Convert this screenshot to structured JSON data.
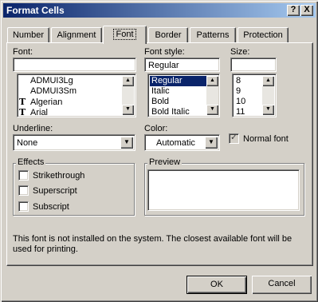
{
  "dialog": {
    "title": "Format Cells",
    "help_label": "?",
    "close_label": "X"
  },
  "tabs": [
    {
      "label": "Number"
    },
    {
      "label": "Alignment"
    },
    {
      "label": "Font"
    },
    {
      "label": "Border"
    },
    {
      "label": "Patterns"
    },
    {
      "label": "Protection"
    }
  ],
  "font": {
    "label": "Font:",
    "value": "",
    "items": [
      {
        "label": "ADMUI3Lg",
        "glyph": ""
      },
      {
        "label": "ADMUI3Sm",
        "glyph": ""
      },
      {
        "label": "Algerian",
        "glyph": "T"
      },
      {
        "label": "Arial",
        "glyph": "T"
      }
    ]
  },
  "font_style": {
    "label": "Font style:",
    "value": "Regular",
    "items": [
      {
        "label": "Regular"
      },
      {
        "label": "Italic"
      },
      {
        "label": "Bold"
      },
      {
        "label": "Bold Italic"
      }
    ]
  },
  "size": {
    "label": "Size:",
    "value": "",
    "items": [
      {
        "label": "8"
      },
      {
        "label": "9"
      },
      {
        "label": "10"
      },
      {
        "label": "11"
      }
    ]
  },
  "underline": {
    "label": "Underline:",
    "value": "None"
  },
  "color": {
    "label": "Color:",
    "value": "Automatic"
  },
  "normal_font": {
    "label": "Normal font",
    "checked": true
  },
  "effects": {
    "label": "Effects",
    "items": [
      {
        "label": "Strikethrough",
        "checked": false
      },
      {
        "label": "Superscript",
        "checked": false
      },
      {
        "label": "Subscript",
        "checked": false
      }
    ]
  },
  "preview": {
    "label": "Preview"
  },
  "message": {
    "line1": "This font is not installed on the system.  The closest available font will be",
    "line2": "used for printing."
  },
  "buttons": {
    "ok": "OK",
    "cancel": "Cancel"
  },
  "icons": {
    "scroll_up": "scroll-up-icon",
    "scroll_down": "scroll-down-icon",
    "dropdown": "chevron-down-icon",
    "truetype": "truetype-font-icon"
  }
}
